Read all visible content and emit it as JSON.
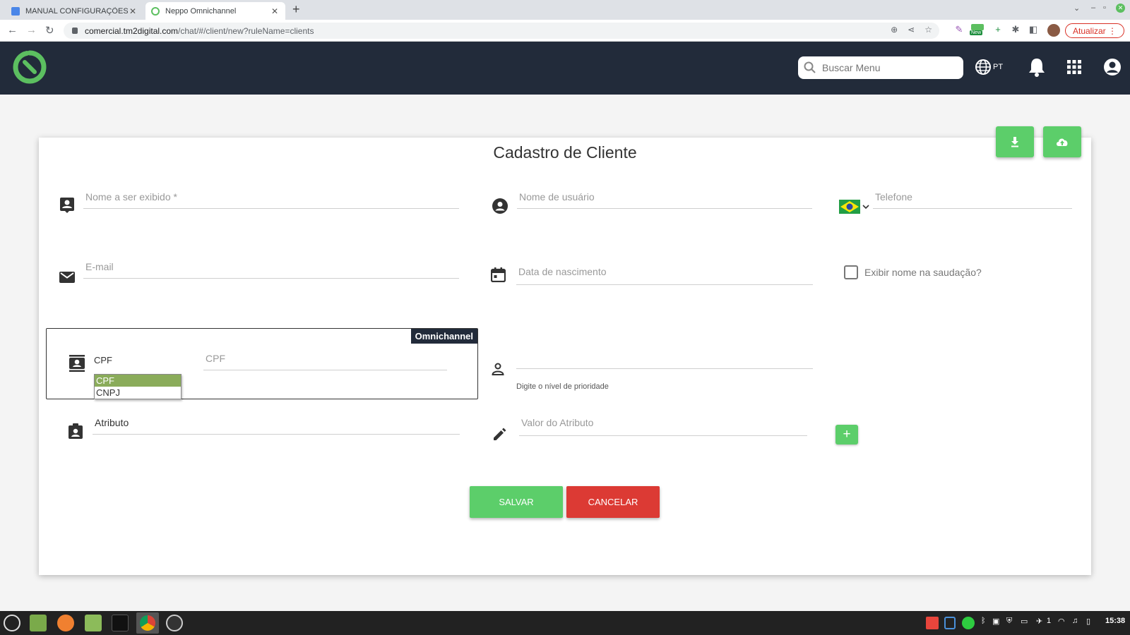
{
  "browser": {
    "tabs": [
      {
        "title": "MANUAL CONFIGURAÇÕES D"
      },
      {
        "title": "Neppo Omnichannel"
      }
    ],
    "url_host": "comercial.tm2digital.com",
    "url_path": "/chat/#/client/new?ruleName=clients",
    "update_button": "Atualizar",
    "new_badge": "New"
  },
  "header": {
    "search_placeholder": "Buscar Menu",
    "language": "PT"
  },
  "form": {
    "title": "Cadastro de Cliente",
    "display_name_placeholder": "Nome a ser exibido *",
    "username_placeholder": "Nome de usuário",
    "phone_placeholder": "Telefone",
    "email_placeholder": "E-mail",
    "birthdate_placeholder": "Data de nascimento",
    "greeting_checkbox_label": "Exibir nome na saudação?",
    "omnichannel_tag": "Omnichannel",
    "document_type_selected": "CPF",
    "document_type_options": [
      "CPF",
      "CNPJ"
    ],
    "document_placeholder": "CPF",
    "priority_hint": "Digite o nível de prioridade",
    "attribute_value": "Atributo",
    "attribute_value_placeholder": "Valor do Atributo",
    "add_label": "+",
    "save_label": "SALVAR",
    "cancel_label": "CANCELAR"
  },
  "taskbar": {
    "clock": "15:38",
    "tray_count": "1"
  },
  "colors": {
    "header_bg": "#222b3a",
    "accent_green": "#5cce6a",
    "cancel_red": "#dc3a34",
    "logo_green": "#5cbf60"
  }
}
